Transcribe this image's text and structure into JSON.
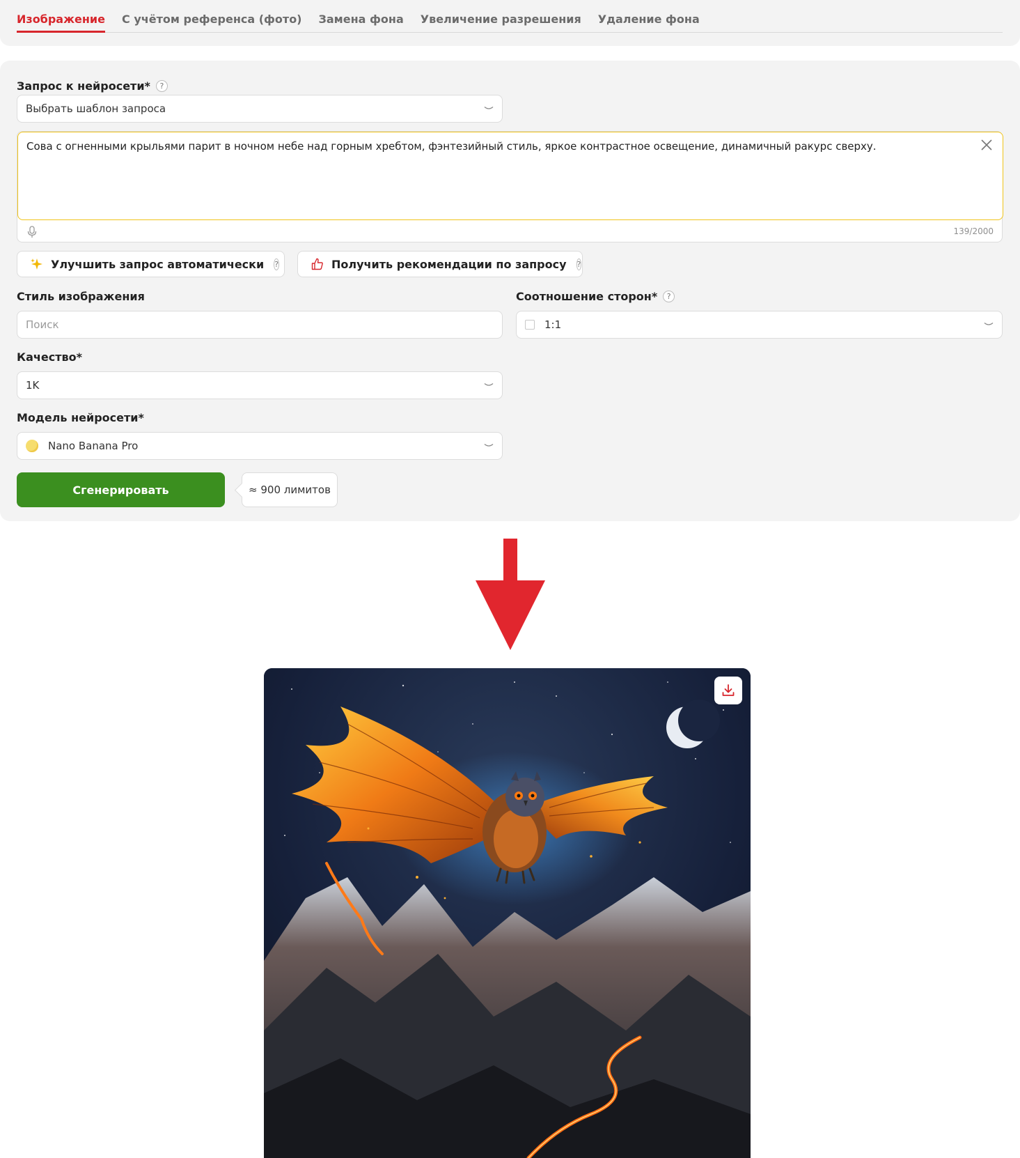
{
  "tabs": [
    {
      "label": "Изображение",
      "active": true
    },
    {
      "label": "С учётом референса (фото)",
      "active": false
    },
    {
      "label": "Замена фона",
      "active": false
    },
    {
      "label": "Увеличение разрешения",
      "active": false
    },
    {
      "label": "Удаление фона",
      "active": false
    }
  ],
  "prompt": {
    "label": "Запрос к нейросети*",
    "template_select": "Выбрать шаблон запроса",
    "text": "Сова с огненными крыльями парит в ночном небе над горным хребтом, фэнтезийный стиль, яркое контрастное освещение, динамичный ракурс сверху.",
    "counter": "139/2000"
  },
  "actions": {
    "improve": "Улучшить запрос автоматически",
    "recommend": "Получить рекомендации по запросу"
  },
  "style": {
    "label": "Стиль изображения",
    "placeholder": "Поиск"
  },
  "aspect": {
    "label": "Соотношение сторон*",
    "value": "1:1"
  },
  "quality": {
    "label": "Качество*",
    "value": "1K"
  },
  "model": {
    "label": "Модель нейросети*",
    "value": "Nano Banana Pro"
  },
  "generate": {
    "label": "Сгенерировать",
    "cost": "≈ 900 лимитов"
  },
  "help_glyph": "?",
  "colors": {
    "accent": "#d7262c",
    "generate": "#3b8f1f",
    "focus": "#f0c419"
  }
}
